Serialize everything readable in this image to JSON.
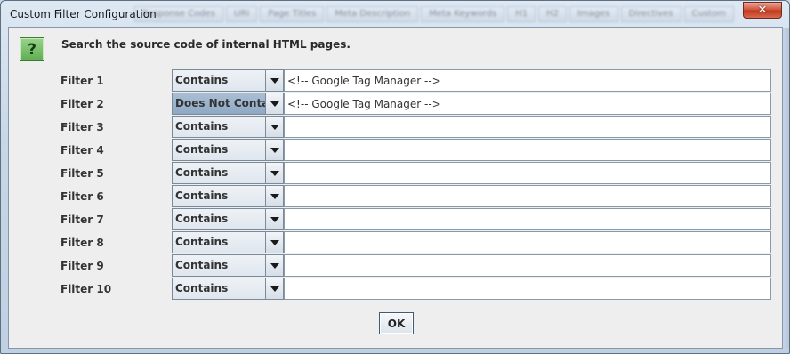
{
  "window": {
    "title": "Custom Filter Configuration",
    "close_glyph": "✕"
  },
  "background_tabs": [
    "Response Codes",
    "URI",
    "Page Titles",
    "Meta Description",
    "Meta Keywords",
    "H1",
    "H2",
    "Images",
    "Directives",
    "Custom"
  ],
  "help": {
    "icon": "help-question-icon",
    "glyph": "?"
  },
  "instruction": "Search the source code of internal HTML pages.",
  "filters": [
    {
      "label": "Filter 1",
      "mode": "Contains",
      "value": "<!-- Google Tag Manager -->",
      "selected": false
    },
    {
      "label": "Filter 2",
      "mode": "Does Not Contain",
      "value": "<!-- Google Tag Manager -->",
      "selected": true
    },
    {
      "label": "Filter 3",
      "mode": "Contains",
      "value": "",
      "selected": false
    },
    {
      "label": "Filter 4",
      "mode": "Contains",
      "value": "",
      "selected": false
    },
    {
      "label": "Filter 5",
      "mode": "Contains",
      "value": "",
      "selected": false
    },
    {
      "label": "Filter 6",
      "mode": "Contains",
      "value": "",
      "selected": false
    },
    {
      "label": "Filter 7",
      "mode": "Contains",
      "value": "",
      "selected": false
    },
    {
      "label": "Filter 8",
      "mode": "Contains",
      "value": "",
      "selected": false
    },
    {
      "label": "Filter 9",
      "mode": "Contains",
      "value": "",
      "selected": false
    },
    {
      "label": "Filter 10",
      "mode": "Contains",
      "value": "",
      "selected": false
    }
  ],
  "buttons": {
    "ok_label": "OK"
  },
  "colors": {
    "help_icon": "#5fae52",
    "close_button": "#c13a1f",
    "selected_combo": "#9bb3cc"
  }
}
